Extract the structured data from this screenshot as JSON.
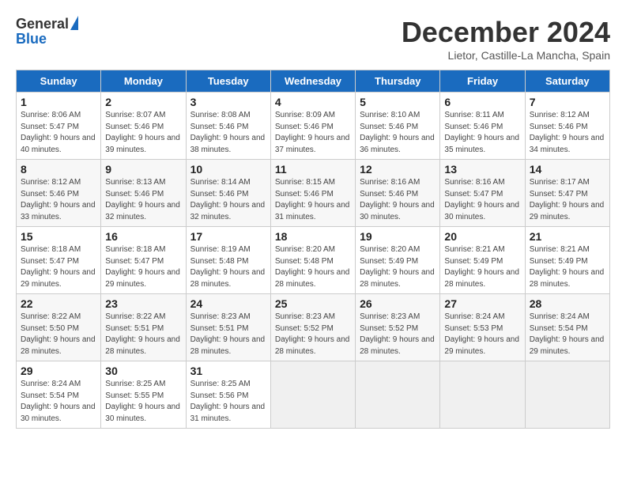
{
  "header": {
    "logo_general": "General",
    "logo_blue": "Blue",
    "title": "December 2024",
    "subtitle": "Lietor, Castille-La Mancha, Spain"
  },
  "weekdays": [
    "Sunday",
    "Monday",
    "Tuesday",
    "Wednesday",
    "Thursday",
    "Friday",
    "Saturday"
  ],
  "weeks": [
    [
      {
        "day": "1",
        "sunrise": "Sunrise: 8:06 AM",
        "sunset": "Sunset: 5:47 PM",
        "daylight": "Daylight: 9 hours and 40 minutes."
      },
      {
        "day": "2",
        "sunrise": "Sunrise: 8:07 AM",
        "sunset": "Sunset: 5:46 PM",
        "daylight": "Daylight: 9 hours and 39 minutes."
      },
      {
        "day": "3",
        "sunrise": "Sunrise: 8:08 AM",
        "sunset": "Sunset: 5:46 PM",
        "daylight": "Daylight: 9 hours and 38 minutes."
      },
      {
        "day": "4",
        "sunrise": "Sunrise: 8:09 AM",
        "sunset": "Sunset: 5:46 PM",
        "daylight": "Daylight: 9 hours and 37 minutes."
      },
      {
        "day": "5",
        "sunrise": "Sunrise: 8:10 AM",
        "sunset": "Sunset: 5:46 PM",
        "daylight": "Daylight: 9 hours and 36 minutes."
      },
      {
        "day": "6",
        "sunrise": "Sunrise: 8:11 AM",
        "sunset": "Sunset: 5:46 PM",
        "daylight": "Daylight: 9 hours and 35 minutes."
      },
      {
        "day": "7",
        "sunrise": "Sunrise: 8:12 AM",
        "sunset": "Sunset: 5:46 PM",
        "daylight": "Daylight: 9 hours and 34 minutes."
      }
    ],
    [
      {
        "day": "8",
        "sunrise": "Sunrise: 8:12 AM",
        "sunset": "Sunset: 5:46 PM",
        "daylight": "Daylight: 9 hours and 33 minutes."
      },
      {
        "day": "9",
        "sunrise": "Sunrise: 8:13 AM",
        "sunset": "Sunset: 5:46 PM",
        "daylight": "Daylight: 9 hours and 32 minutes."
      },
      {
        "day": "10",
        "sunrise": "Sunrise: 8:14 AM",
        "sunset": "Sunset: 5:46 PM",
        "daylight": "Daylight: 9 hours and 32 minutes."
      },
      {
        "day": "11",
        "sunrise": "Sunrise: 8:15 AM",
        "sunset": "Sunset: 5:46 PM",
        "daylight": "Daylight: 9 hours and 31 minutes."
      },
      {
        "day": "12",
        "sunrise": "Sunrise: 8:16 AM",
        "sunset": "Sunset: 5:46 PM",
        "daylight": "Daylight: 9 hours and 30 minutes."
      },
      {
        "day": "13",
        "sunrise": "Sunrise: 8:16 AM",
        "sunset": "Sunset: 5:47 PM",
        "daylight": "Daylight: 9 hours and 30 minutes."
      },
      {
        "day": "14",
        "sunrise": "Sunrise: 8:17 AM",
        "sunset": "Sunset: 5:47 PM",
        "daylight": "Daylight: 9 hours and 29 minutes."
      }
    ],
    [
      {
        "day": "15",
        "sunrise": "Sunrise: 8:18 AM",
        "sunset": "Sunset: 5:47 PM",
        "daylight": "Daylight: 9 hours and 29 minutes."
      },
      {
        "day": "16",
        "sunrise": "Sunrise: 8:18 AM",
        "sunset": "Sunset: 5:47 PM",
        "daylight": "Daylight: 9 hours and 29 minutes."
      },
      {
        "day": "17",
        "sunrise": "Sunrise: 8:19 AM",
        "sunset": "Sunset: 5:48 PM",
        "daylight": "Daylight: 9 hours and 28 minutes."
      },
      {
        "day": "18",
        "sunrise": "Sunrise: 8:20 AM",
        "sunset": "Sunset: 5:48 PM",
        "daylight": "Daylight: 9 hours and 28 minutes."
      },
      {
        "day": "19",
        "sunrise": "Sunrise: 8:20 AM",
        "sunset": "Sunset: 5:49 PM",
        "daylight": "Daylight: 9 hours and 28 minutes."
      },
      {
        "day": "20",
        "sunrise": "Sunrise: 8:21 AM",
        "sunset": "Sunset: 5:49 PM",
        "daylight": "Daylight: 9 hours and 28 minutes."
      },
      {
        "day": "21",
        "sunrise": "Sunrise: 8:21 AM",
        "sunset": "Sunset: 5:49 PM",
        "daylight": "Daylight: 9 hours and 28 minutes."
      }
    ],
    [
      {
        "day": "22",
        "sunrise": "Sunrise: 8:22 AM",
        "sunset": "Sunset: 5:50 PM",
        "daylight": "Daylight: 9 hours and 28 minutes."
      },
      {
        "day": "23",
        "sunrise": "Sunrise: 8:22 AM",
        "sunset": "Sunset: 5:51 PM",
        "daylight": "Daylight: 9 hours and 28 minutes."
      },
      {
        "day": "24",
        "sunrise": "Sunrise: 8:23 AM",
        "sunset": "Sunset: 5:51 PM",
        "daylight": "Daylight: 9 hours and 28 minutes."
      },
      {
        "day": "25",
        "sunrise": "Sunrise: 8:23 AM",
        "sunset": "Sunset: 5:52 PM",
        "daylight": "Daylight: 9 hours and 28 minutes."
      },
      {
        "day": "26",
        "sunrise": "Sunrise: 8:23 AM",
        "sunset": "Sunset: 5:52 PM",
        "daylight": "Daylight: 9 hours and 28 minutes."
      },
      {
        "day": "27",
        "sunrise": "Sunrise: 8:24 AM",
        "sunset": "Sunset: 5:53 PM",
        "daylight": "Daylight: 9 hours and 29 minutes."
      },
      {
        "day": "28",
        "sunrise": "Sunrise: 8:24 AM",
        "sunset": "Sunset: 5:54 PM",
        "daylight": "Daylight: 9 hours and 29 minutes."
      }
    ],
    [
      {
        "day": "29",
        "sunrise": "Sunrise: 8:24 AM",
        "sunset": "Sunset: 5:54 PM",
        "daylight": "Daylight: 9 hours and 30 minutes."
      },
      {
        "day": "30",
        "sunrise": "Sunrise: 8:25 AM",
        "sunset": "Sunset: 5:55 PM",
        "daylight": "Daylight: 9 hours and 30 minutes."
      },
      {
        "day": "31",
        "sunrise": "Sunrise: 8:25 AM",
        "sunset": "Sunset: 5:56 PM",
        "daylight": "Daylight: 9 hours and 31 minutes."
      },
      null,
      null,
      null,
      null
    ]
  ]
}
